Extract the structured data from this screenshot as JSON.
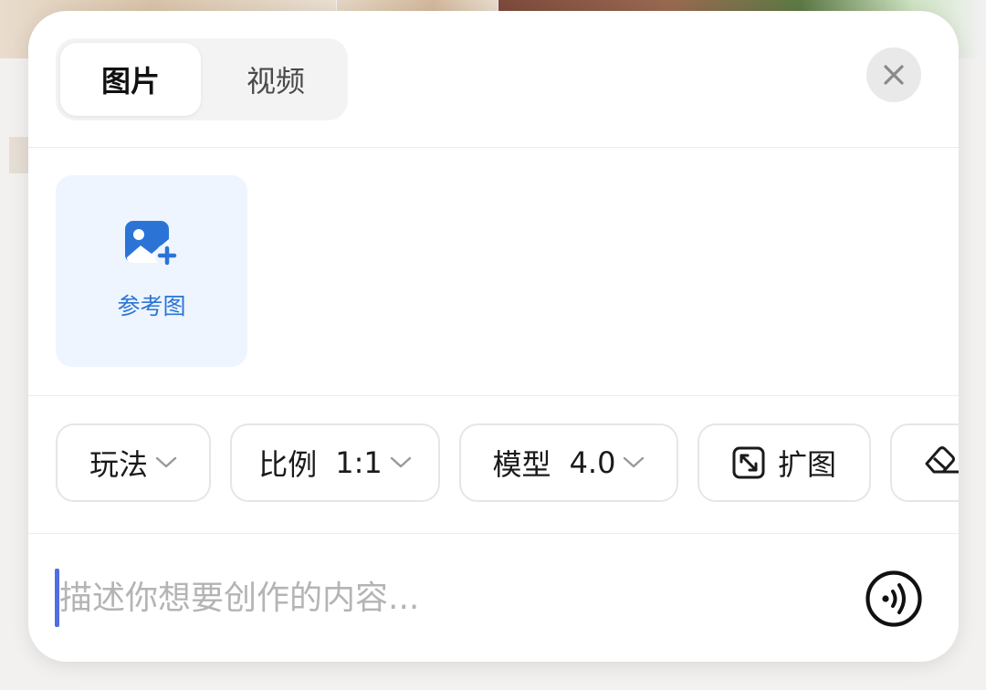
{
  "tabs": [
    {
      "label": "图片",
      "active": true
    },
    {
      "label": "视频",
      "active": false
    }
  ],
  "close_icon": "close-icon",
  "reference": {
    "label": "参考图",
    "icon": "image-add-icon",
    "accent": "#2b74d6"
  },
  "options": {
    "play": {
      "label": "玩法"
    },
    "ratio": {
      "label": "比例",
      "value": "1:1"
    },
    "model": {
      "label": "模型",
      "value": "4.0"
    },
    "expand": {
      "label": "扩图",
      "icon": "expand-icon"
    },
    "erase": {
      "icon": "eraser-icon"
    }
  },
  "prompt": {
    "placeholder": "描述你想要创作的内容...",
    "value": ""
  },
  "voice_icon": "voice-icon",
  "colors": {
    "cursor": "#4f6ee0",
    "reference_bg": "#eef5ff"
  }
}
